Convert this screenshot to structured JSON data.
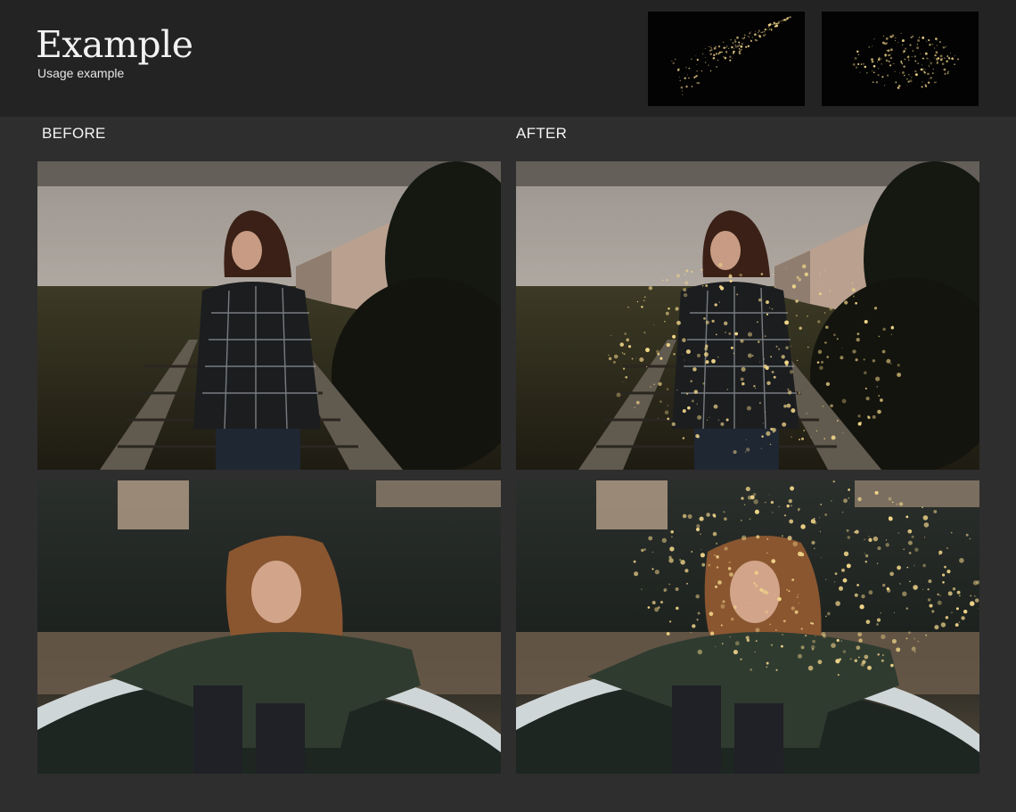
{
  "header": {
    "title": "Example",
    "subtitle": "Usage example",
    "swatches": [
      {
        "name": "dust-spray-preview"
      },
      {
        "name": "dust-cloud-preview"
      }
    ]
  },
  "columns": {
    "before_label": "BEFORE",
    "after_label": "AFTER"
  },
  "photos": [
    {
      "scene": "woman-railway",
      "variant": "before"
    },
    {
      "scene": "woman-railway",
      "variant": "after"
    },
    {
      "scene": "woman-boat",
      "variant": "before"
    },
    {
      "scene": "woman-boat",
      "variant": "after"
    }
  ],
  "colors": {
    "background": "#2e2e2e",
    "header": "#232323",
    "glitter": "#f3d78a"
  }
}
